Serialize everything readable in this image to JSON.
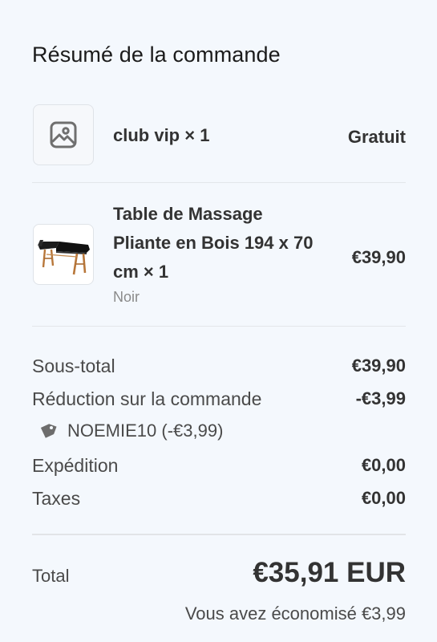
{
  "summary": {
    "title": "Résumé de la commande"
  },
  "items": [
    {
      "name": "club vip × 1",
      "price": "Gratuit",
      "thumbnail_icon": "image-placeholder-icon"
    },
    {
      "name": "Table de Massage Pliante en Bois 194 x 70 cm × 1",
      "variant": "Noir",
      "price": "€39,90",
      "thumbnail_icon": "massage-table-image"
    }
  ],
  "totals": {
    "subtotal_label": "Sous-total",
    "subtotal_value": "€39,90",
    "discount_label": "Réduction sur la commande",
    "discount_value": "-€3,99",
    "discount_code": "NOEMIE10 (-€3,99)",
    "shipping_label": "Expédition",
    "shipping_value": "€0,00",
    "taxes_label": "Taxes",
    "taxes_value": "€0,00",
    "total_label": "Total",
    "total_value": "€35,91 EUR",
    "savings_text": "Vous avez économisé €3,99"
  },
  "colors": {
    "background": "#f4f8fd",
    "text_primary": "#333333",
    "text_secondary": "#4a4a4a",
    "text_muted": "#8a8a8a",
    "divider": "#e3e6ea"
  }
}
